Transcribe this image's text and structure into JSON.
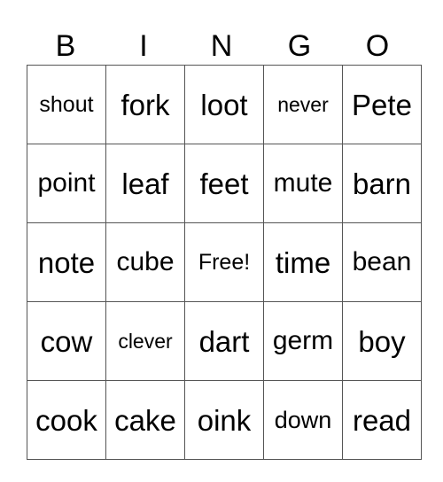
{
  "header": [
    "B",
    "I",
    "N",
    "G",
    "O"
  ],
  "rows": [
    [
      "shout",
      "fork",
      "loot",
      "never",
      "Pete"
    ],
    [
      "point",
      "leaf",
      "feet",
      "mute",
      "barn"
    ],
    [
      "note",
      "cube",
      "Free!",
      "time",
      "bean"
    ],
    [
      "cow",
      "clever",
      "dart",
      "germ",
      "boy"
    ],
    [
      "cook",
      "cake",
      "oink",
      "down",
      "read"
    ]
  ]
}
